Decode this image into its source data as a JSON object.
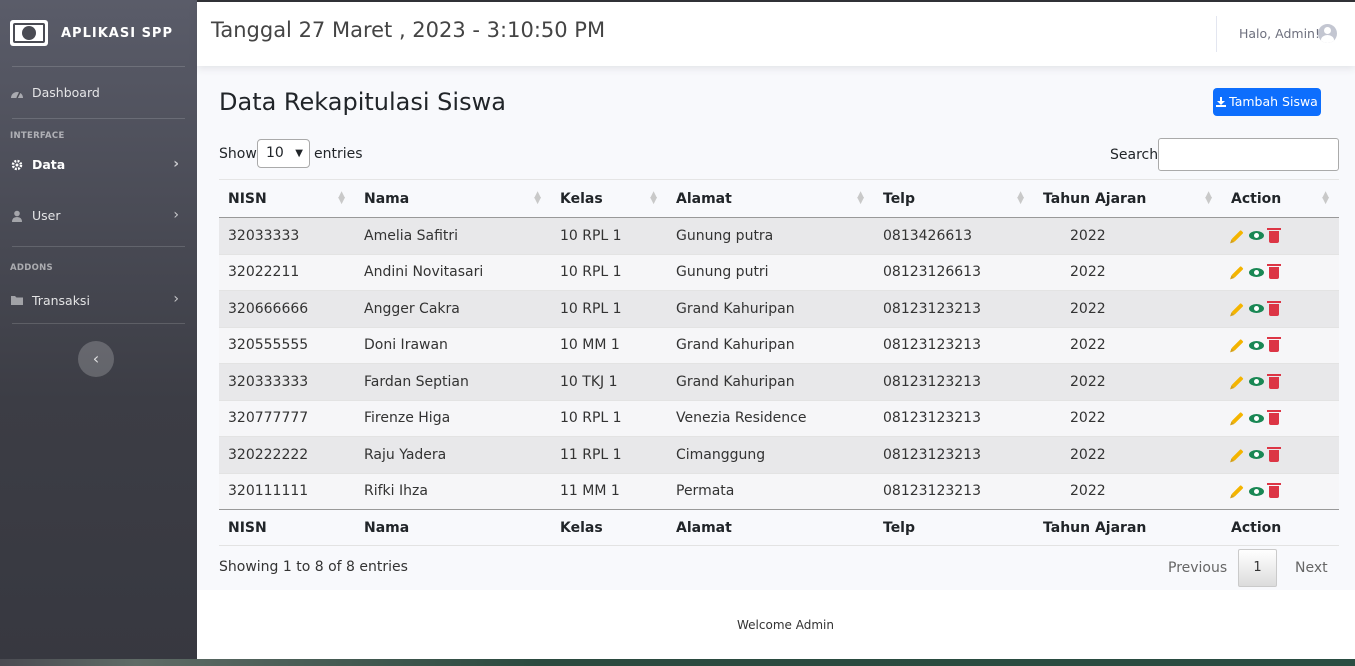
{
  "app": {
    "brand": "APLIKASI SPP"
  },
  "sidebar": {
    "items": [
      {
        "label": "Dashboard",
        "icon": "dashboard-icon"
      },
      {
        "heading": "INTERFACE"
      },
      {
        "label": "Data",
        "icon": "gear-icon",
        "active": true
      },
      {
        "label": "User",
        "icon": "user-icon"
      },
      {
        "heading": "ADDONS"
      },
      {
        "label": "Transaksi",
        "icon": "folder-icon"
      }
    ],
    "headings": {
      "interface": "INTERFACE",
      "addons": "ADDONS"
    },
    "dashboard": "Dashboard",
    "data": "Data",
    "user": "User",
    "transaksi": "Transaksi",
    "toggle_icon": "chevron-left-icon"
  },
  "topbar": {
    "datetime": "Tanggal 27 Maret , 2023 - 3:10:50 PM",
    "greeting": "Halo, Admin!"
  },
  "main": {
    "title": "Data Rekapitulasi Siswa",
    "add_button": "Tambah Siswa",
    "show_label": "Show",
    "entries_value": "10",
    "entries_label": "entries",
    "search_label": "Search:",
    "search_value": ""
  },
  "table": {
    "columns": [
      "NISN",
      "Nama",
      "Kelas",
      "Alamat",
      "Telp",
      "Tahun Ajaran",
      "Action"
    ],
    "rows": [
      [
        "32033333",
        "Amelia Safitri",
        "10 RPL 1",
        "Gunung putra",
        "0813426613",
        "2022"
      ],
      [
        "32022211",
        "Andini Novitasari",
        "10 RPL 1",
        "Gunung putri",
        "08123126613",
        "2022"
      ],
      [
        "320666666",
        "Angger Cakra",
        "10 RPL 1",
        "Grand Kahuripan",
        "08123123213",
        "2022"
      ],
      [
        "320555555",
        "Doni Irawan",
        "10 MM 1",
        "Grand Kahuripan",
        "08123123213",
        "2022"
      ],
      [
        "320333333",
        "Fardan Septian",
        "10 TKJ 1",
        "Grand Kahuripan",
        "08123123213",
        "2022"
      ],
      [
        "320777777",
        "Firenze Higa",
        "10 RPL 1",
        "Venezia Residence",
        "08123123213",
        "2022"
      ],
      [
        "320222222",
        "Raju Yadera",
        "11 RPL 1",
        "Cimanggung",
        "08123123213",
        "2022"
      ],
      [
        "320111111",
        "Rifki Ihza",
        "11 MM 1",
        "Permata",
        "08123123213",
        "2022"
      ]
    ],
    "action_icons": [
      "pencil-icon",
      "eye-icon",
      "trash-icon"
    ]
  },
  "pagination": {
    "info": "Showing 1 to 8 of 8 entries",
    "previous": "Previous",
    "current": "1",
    "next": "Next"
  },
  "footer": {
    "text": "Welcome Admin"
  },
  "colors": {
    "primary": "#0d6efd",
    "edit": "#f4b400",
    "view": "#198754",
    "delete": "#dc3545"
  }
}
